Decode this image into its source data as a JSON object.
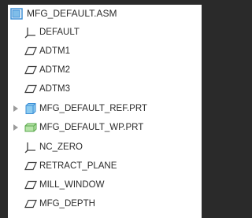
{
  "tree": {
    "root": {
      "label": "MFG_DEFAULT.ASM",
      "icon": "assembly-icon"
    },
    "items": [
      {
        "label": "DEFAULT",
        "icon": "coordinate-system-icon",
        "expandable": false
      },
      {
        "label": "ADTM1",
        "icon": "datum-plane-icon",
        "expandable": false
      },
      {
        "label": "ADTM2",
        "icon": "datum-plane-icon",
        "expandable": false
      },
      {
        "label": "ADTM3",
        "icon": "datum-plane-icon",
        "expandable": false
      },
      {
        "label": "MFG_DEFAULT_REF.PRT",
        "icon": "reference-part-icon",
        "expandable": true
      },
      {
        "label": "MFG_DEFAULT_WP.PRT",
        "icon": "workpiece-part-icon",
        "expandable": true
      },
      {
        "label": "NC_ZERO",
        "icon": "coordinate-system-icon",
        "expandable": false
      },
      {
        "label": "RETRACT_PLANE",
        "icon": "datum-plane-icon",
        "expandable": false
      },
      {
        "label": "MILL_WINDOW",
        "icon": "datum-plane-icon",
        "expandable": false
      },
      {
        "label": "MFG_DEPTH",
        "icon": "datum-plane-icon",
        "expandable": false
      }
    ]
  },
  "colors": {
    "assembly_blue": "#3d8fd6",
    "reference_blue": "#5cb0e8",
    "workpiece_green": "#7bc96f",
    "icon_gray": "#404040",
    "expander_gray": "#9a9a9a"
  }
}
